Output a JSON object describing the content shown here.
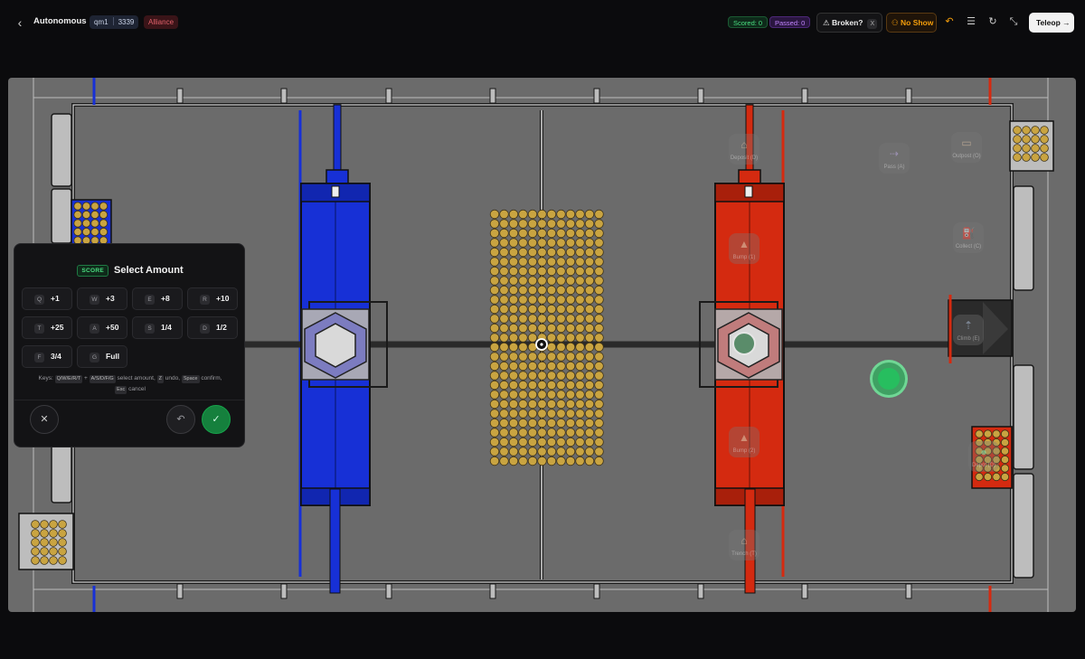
{
  "header": {
    "back_icon": "chevron-left-icon",
    "title": "Autonomous",
    "match": "qm1",
    "team": "3339",
    "alliance": "Alliance",
    "scored": "Scored: 0",
    "passed": "Passed: 0",
    "broken_label": "Broken?",
    "broken_key": "X",
    "no_show_label": "No Show",
    "teleop_label": "Teleop",
    "icons": [
      "undo-icon",
      "list-icon",
      "refresh-icon",
      "minimize-icon"
    ]
  },
  "field": {
    "zones": [
      {
        "label": "Deposit (D)",
        "icon": "home-icon"
      },
      {
        "label": "Pass (A)",
        "icon": "pass-icon"
      },
      {
        "label": "Outpost (O)",
        "icon": "inbox-icon"
      },
      {
        "label": "Collect (C)",
        "icon": "fuel-icon"
      },
      {
        "label": "Bump (1)",
        "icon": "bump-icon"
      },
      {
        "label": "Climb (E)",
        "icon": "climb-icon"
      },
      {
        "label": "Bump (2)",
        "icon": "bump-icon"
      },
      {
        "label": "Depot (D)",
        "icon": "depot-icon"
      },
      {
        "label": "Trench (T)",
        "icon": "trench-icon"
      }
    ]
  },
  "modal": {
    "tag": "SCORE",
    "title": "Select Amount",
    "amounts": [
      {
        "key": "Q",
        "value": "+1"
      },
      {
        "key": "W",
        "value": "+3"
      },
      {
        "key": "E",
        "value": "+8"
      },
      {
        "key": "R",
        "value": "+10"
      },
      {
        "key": "T",
        "value": "+25"
      },
      {
        "key": "A",
        "value": "+50"
      },
      {
        "key": "S",
        "value": "1/4"
      },
      {
        "key": "D",
        "value": "1/2"
      },
      {
        "key": "F",
        "value": "3/4"
      },
      {
        "key": "G",
        "value": "Full"
      }
    ],
    "hint": {
      "prefix": "Keys:",
      "k1": "Q/W/E/R/T",
      "plus": "+",
      "k2": "A/S/D/F/G",
      "t1": "select amount,",
      "k3": "Z",
      "t2": "undo,",
      "k4": "Space",
      "t3": "confirm,",
      "k5": "Esc",
      "t4": "cancel"
    }
  },
  "colors": {
    "blue": "#1730d6",
    "red": "#d42a10",
    "fuel": "#c9a441",
    "field": "#6b6b6b"
  }
}
